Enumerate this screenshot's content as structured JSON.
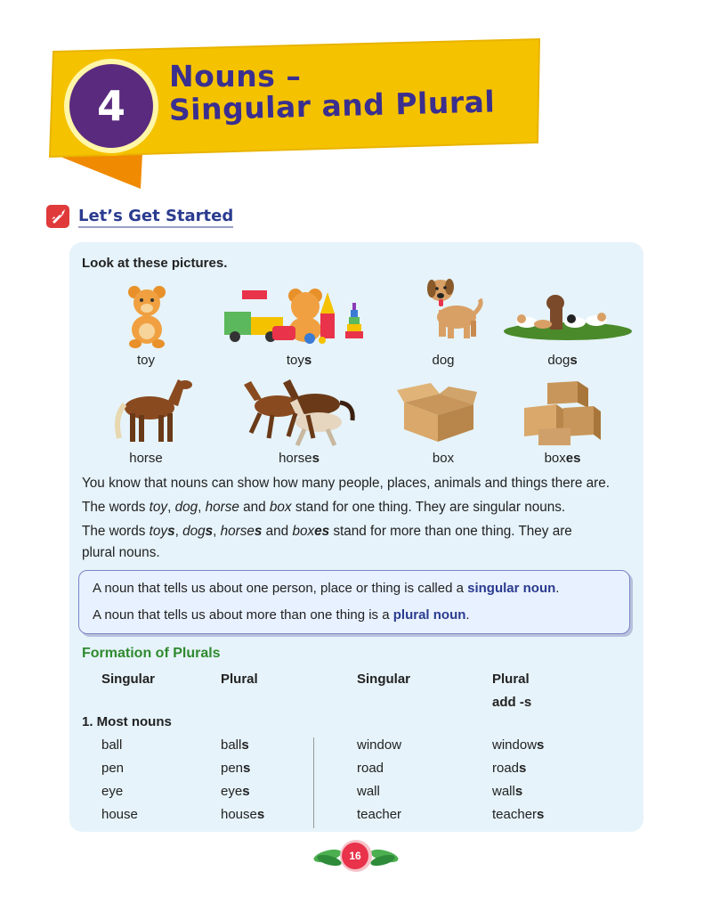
{
  "chapter": {
    "number": "4",
    "title_line1": "Nouns –",
    "title_line2": "Singular and Plural"
  },
  "section": {
    "title": "Let’s Get Started",
    "icon": "rocket-icon"
  },
  "intro": "Look at these pictures.",
  "pictures": [
    {
      "stem": "toy",
      "suffix": "",
      "icon": "teddy-bear-icon"
    },
    {
      "stem": "toy",
      "suffix": "s",
      "icon": "toys-group-icon"
    },
    {
      "stem": "dog",
      "suffix": "",
      "icon": "dog-icon"
    },
    {
      "stem": "dog",
      "suffix": "s",
      "icon": "dogs-group-icon"
    },
    {
      "stem": "horse",
      "suffix": "",
      "icon": "horse-icon"
    },
    {
      "stem": "horse",
      "suffix": "s",
      "icon": "horses-group-icon"
    },
    {
      "stem": "box",
      "suffix": "",
      "icon": "box-icon"
    },
    {
      "stem": "box",
      "suffix": "es",
      "icon": "boxes-group-icon"
    }
  ],
  "para1": "You know that nouns can show how many people, places, animals and things there are.",
  "para2": {
    "p1": "The words ",
    "w1": "toy",
    "s1": ", ",
    "w2": "dog",
    "s2": ", ",
    "w3": "horse",
    "s3": " and ",
    "w4": "box",
    "p2": " stand for one thing. They are singular nouns."
  },
  "para3": {
    "p1": "The words ",
    "w1": "toy",
    "e1": "s",
    "s1": ", ",
    "w2": "dog",
    "e2": "s",
    "s2": ", ",
    "w3": "horse",
    "e3": "s",
    "s3": " and ",
    "w4": "box",
    "e4": "es",
    "p2": " stand for more than one thing. They are",
    "line2": "plural nouns."
  },
  "definitions": {
    "d1_text": "A noun that tells us about one person, place or thing is called a ",
    "d1_term": "singular noun",
    "d2_text": "A noun that tells us about more than one thing is a ",
    "d2_term": "plural noun",
    "period": "."
  },
  "formation": {
    "heading": "Formation of Plurals",
    "col_singular": "Singular",
    "col_plural": "Plural",
    "rule_hint": "add -s",
    "rule1": "1.  Most nouns",
    "left": [
      {
        "singular": "ball",
        "plural_stem": "ball",
        "suffix": "s"
      },
      {
        "singular": "pen",
        "plural_stem": "pen",
        "suffix": "s"
      },
      {
        "singular": "eye",
        "plural_stem": "eye",
        "suffix": "s"
      },
      {
        "singular": "house",
        "plural_stem": "house",
        "suffix": "s"
      }
    ],
    "right": [
      {
        "singular": "window",
        "plural_stem": "window",
        "suffix": "s"
      },
      {
        "singular": "road",
        "plural_stem": "road",
        "suffix": "s"
      },
      {
        "singular": "wall",
        "plural_stem": "wall",
        "suffix": "s"
      },
      {
        "singular": "teacher",
        "plural_stem": "teacher",
        "suffix": "s"
      }
    ]
  },
  "page_number": "16",
  "colors": {
    "banner": "#f5c200",
    "banner_shadow": "#f08a00",
    "title": "#3a2f8f",
    "circle": "#5a2a7e",
    "panel": "#e6f3fa",
    "accent_green": "#2f8a2f",
    "term": "#2a3b8f"
  }
}
